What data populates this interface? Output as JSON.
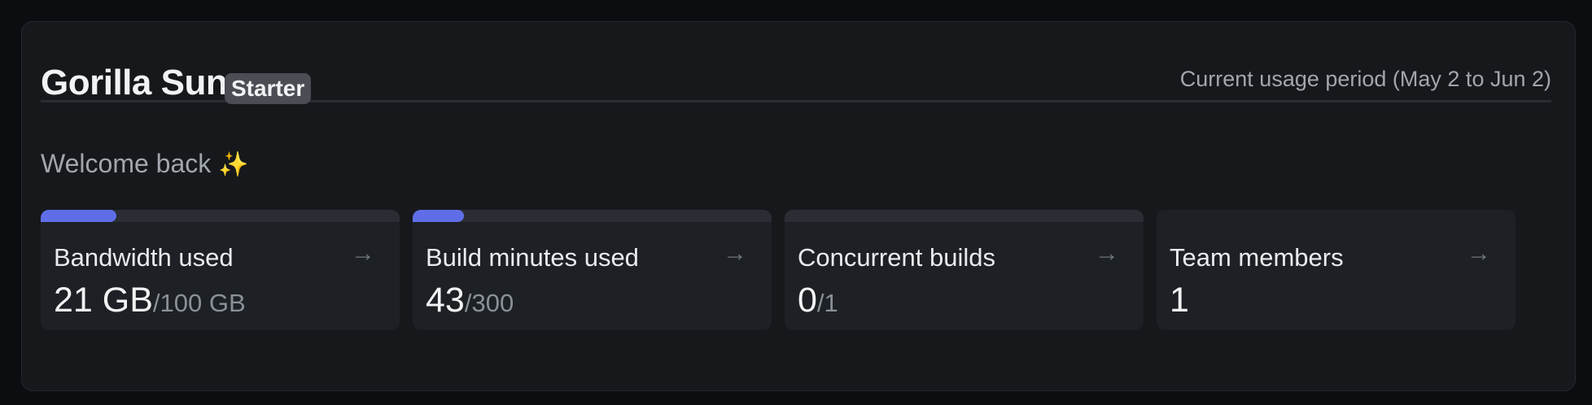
{
  "header": {
    "project_name": "Gorilla Sun",
    "plan_badge": "Starter",
    "usage_period": "Current usage period (May 2 to Jun 2)"
  },
  "welcome": {
    "text": "Welcome back",
    "emoji": "✨"
  },
  "colors": {
    "accent": "#5f6ee8",
    "panel_bg": "#16181c",
    "card_bg": "#1d2024"
  },
  "cards": [
    {
      "label": "Bandwidth used",
      "value": "21 GB",
      "limit": "/100 GB",
      "progress_fraction": 0.21,
      "arrow": "→"
    },
    {
      "label": "Build minutes used",
      "value": "43",
      "limit": "/300",
      "progress_fraction": 0.143,
      "arrow": "→"
    },
    {
      "label": "Concurrent builds",
      "value": "0",
      "limit": "/1",
      "progress_fraction": 0.0,
      "arrow": "→"
    },
    {
      "label": "Team members",
      "value": "1",
      "limit": "",
      "arrow": "→"
    }
  ]
}
